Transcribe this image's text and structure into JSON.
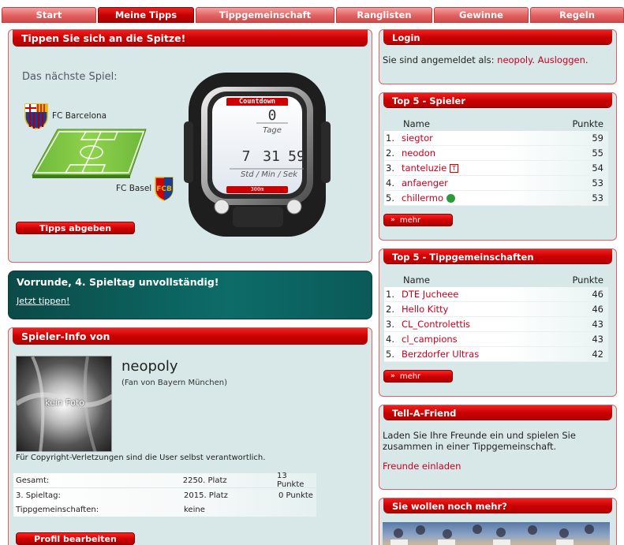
{
  "nav": {
    "tabs": [
      {
        "label": "Start"
      },
      {
        "label": "Meine Tipps"
      },
      {
        "label": "Tippgemeinschaft"
      },
      {
        "label": "Ranglisten"
      },
      {
        "label": "Gewinne"
      },
      {
        "label": "Regeln"
      }
    ],
    "active": "Meine Tipps"
  },
  "hero": {
    "title": "Tippen Sie sich an die Spitze!",
    "next_game_label": "Das nächste Spiel:",
    "home_team": "FC Barcelona",
    "away_team": "FC Basel",
    "button": "Tipps abgeben"
  },
  "countdown": {
    "title": "Countdown",
    "days": "0",
    "days_label": "Tage",
    "hours": "7",
    "minutes": "31",
    "seconds": "59",
    "units_label": "Std / Min / Sek",
    "brand": "300m"
  },
  "notice": {
    "title": "Vorrunde, 4. Spieltag unvollständig!",
    "link": "Jetzt tippen!"
  },
  "player": {
    "header": "Spieler-Info von",
    "username": "neopoly",
    "fan_of": "(Fan von Bayern München)",
    "photo_text": "kein Foto",
    "copyright": "Für Copyright-Verletzungen sind die User selbst verantwortlich.",
    "stats": [
      {
        "label": "Gesamt:",
        "place": "2250. Platz",
        "points": "13 Punkte"
      },
      {
        "label": "3. Spieltag:",
        "place": "2015. Platz",
        "points": "0 Punkte"
      },
      {
        "label": "Tippgemeinschaften:",
        "place": "keine",
        "points": ""
      }
    ],
    "edit_button": "Profil bearbeiten"
  },
  "login": {
    "title": "Login",
    "text": "Sie sind angemeldet als:",
    "user": "neopoly",
    "dot": ".",
    "logout": "Ausloggen",
    "end": "."
  },
  "top_players": {
    "title": "Top 5 - Spieler",
    "col_name": "Name",
    "col_points": "Punkte",
    "rows": [
      {
        "rank": "1.",
        "name": "siegtor",
        "points": "59"
      },
      {
        "rank": "2.",
        "name": "neodon",
        "points": "55"
      },
      {
        "rank": "3.",
        "name": "tanteluzie",
        "points": "54"
      },
      {
        "rank": "4.",
        "name": "anfaenger",
        "points": "53"
      },
      {
        "rank": "5.",
        "name": "chillermo",
        "points": "53"
      }
    ],
    "more": "mehr"
  },
  "top_groups": {
    "title": "Top 5 - Tippgemeinschaften",
    "col_name": "Name",
    "col_points": "Punkte",
    "rows": [
      {
        "rank": "1.",
        "name": "DTE Jucheee",
        "points": "46"
      },
      {
        "rank": "2.",
        "name": "Hello Kitty",
        "points": "46"
      },
      {
        "rank": "3.",
        "name": "CL_Controlettis",
        "points": "43"
      },
      {
        "rank": "4.",
        "name": "cl_campions",
        "points": "43"
      },
      {
        "rank": "5.",
        "name": "Berzdorfer Ultras",
        "points": "42"
      }
    ],
    "more": "mehr"
  },
  "tell_friend": {
    "title": "Tell-A-Friend",
    "text": "Laden Sie Ihre Freunde ein und spielen Sie zusammen in einer Tippgemeinschaft.",
    "link": "Freunde einladen"
  },
  "more_box": {
    "title": "Sie wollen noch mehr?"
  },
  "colors": {
    "accent": "#c80000",
    "panel_bg": "#d8e8e8",
    "link": "#c8001e",
    "notice_bg": "#0a5a58"
  }
}
